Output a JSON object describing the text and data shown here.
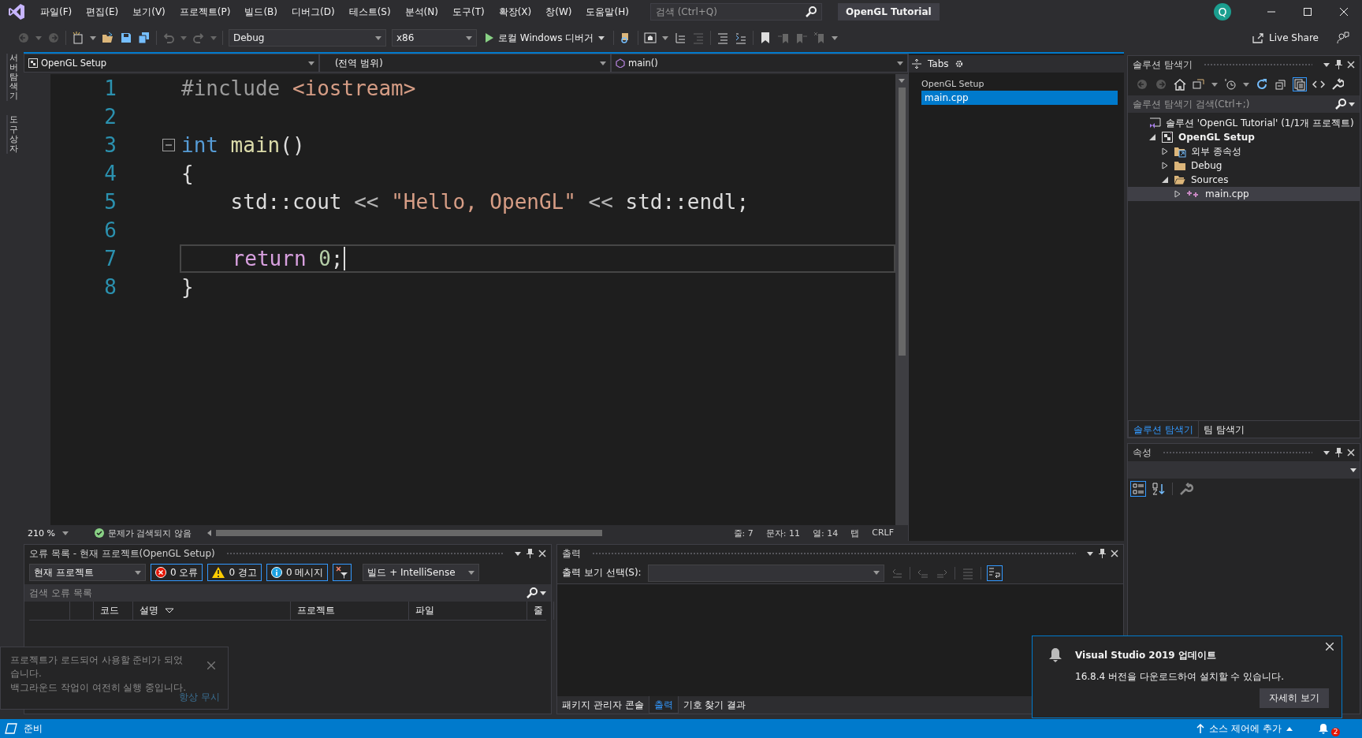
{
  "window": {
    "title": "OpenGL Tutorial"
  },
  "menu": [
    "파일(F)",
    "편집(E)",
    "보기(V)",
    "프로젝트(P)",
    "빌드(B)",
    "디버그(D)",
    "테스트(S)",
    "분석(N)",
    "도구(T)",
    "확장(X)",
    "창(W)",
    "도움말(H)"
  ],
  "search": {
    "placeholder": "검색 (Ctrl+Q)"
  },
  "account": {
    "initial": "Q"
  },
  "toolbar": {
    "configuration": "Debug",
    "platform": "x86",
    "run": "로컬 Windows 디버거",
    "live_share": "Live Share"
  },
  "side_tabs": [
    "서버 탐색기",
    "도구 상자"
  ],
  "editor": {
    "project": "OpenGL Setup",
    "scope": "(전역 범위)",
    "member": "main()",
    "lines": [
      {
        "number": "1",
        "foldable": false,
        "current": false,
        "tokens": [
          {
            "text": "#include ",
            "kind": "preproc"
          },
          {
            "text": "<iostream>",
            "kind": "string"
          }
        ]
      },
      {
        "number": "2",
        "foldable": false,
        "current": false
      },
      {
        "number": "3",
        "foldable": true,
        "current": false,
        "tokens": [
          {
            "text": "int",
            "kind": "keyword"
          },
          {
            "text": " main",
            "kind": "func"
          },
          {
            "text": "()",
            "kind": "plain"
          }
        ]
      },
      {
        "number": "4",
        "foldable": false,
        "current": false,
        "tokens": [
          {
            "text": "{",
            "kind": "plain"
          }
        ]
      },
      {
        "number": "5",
        "foldable": false,
        "current": false,
        "tokens": [
          {
            "text": "    std::cout",
            "kind": "plain"
          },
          {
            "text": " << ",
            "kind": "punct"
          },
          {
            "text": "\"Hello, OpenGL\"",
            "kind": "string"
          },
          {
            "text": " << ",
            "kind": "punct"
          },
          {
            "text": "std::endl;",
            "kind": "plain"
          }
        ]
      },
      {
        "number": "6",
        "foldable": false,
        "current": false
      },
      {
        "number": "7",
        "foldable": false,
        "current": true,
        "tokens": [
          {
            "text": "    return",
            "kind": "control"
          },
          {
            "text": " 0",
            "kind": "number"
          },
          {
            "text": ";",
            "kind": "plain"
          }
        ]
      },
      {
        "number": "8",
        "foldable": false,
        "current": false,
        "tokens": [
          {
            "text": "}",
            "kind": "plain"
          }
        ]
      }
    ],
    "zoom": "210 %",
    "issues": "문제가 검색되지 않음",
    "position": [
      "줄: 7",
      "문자: 11",
      "열: 14",
      "탭",
      "CRLF"
    ]
  },
  "tabs_panel": {
    "title": "Tabs",
    "groups": [
      {
        "name": "OpenGL Setup",
        "items": [
          {
            "label": "main.cpp",
            "selected": true
          }
        ]
      }
    ]
  },
  "solution_explorer": {
    "title": "솔루션 탐색기",
    "search_placeholder": "솔루션 탐색기 검색(Ctrl+;)",
    "tree": [
      {
        "kind": "solution",
        "label": "솔루션 'OpenGL Tutorial' (1/1개 프로젝트)",
        "selected": false,
        "children": [
          {
            "kind": "project",
            "label": "OpenGL Setup",
            "expanded": true,
            "selected": false,
            "children": [
              {
                "kind": "references",
                "label": "외부 종속성",
                "expanded": false,
                "selected": false
              },
              {
                "kind": "folder",
                "label": "Debug",
                "expanded": false,
                "selected": false
              },
              {
                "kind": "folder",
                "label": "Sources",
                "expanded": true,
                "selected": false,
                "children": [
                  {
                    "kind": "file",
                    "label": "main.cpp",
                    "expanded": false,
                    "selected": true
                  }
                ]
              }
            ]
          }
        ]
      }
    ],
    "tabs": [
      {
        "label": "솔루션 탐색기",
        "selected": true
      },
      {
        "label": "팀 탐색기",
        "selected": false
      }
    ]
  },
  "properties": {
    "title": "속성"
  },
  "error_list": {
    "title": "오류 목록 - 현재 프로젝트(OpenGL Setup)",
    "scope": "현재 프로젝트",
    "filters": [
      {
        "kind": "error",
        "label": "0 오류",
        "selected": true
      },
      {
        "kind": "warning",
        "label": "0 경고",
        "selected": true
      },
      {
        "kind": "info",
        "label": "0 메시지",
        "selected": true
      }
    ],
    "source": "빌드 + IntelliSense",
    "search_placeholder": "검색 오류 목록",
    "columns": [
      {
        "label": "코드",
        "sorted": false
      },
      {
        "label": "설명",
        "sorted": true
      },
      {
        "label": "프로젝트",
        "sorted": false
      },
      {
        "label": "파일",
        "sorted": false
      },
      {
        "label": "줄",
        "sorted": false
      }
    ]
  },
  "output": {
    "title": "출력",
    "source_label": "출력 보기 선택(S):",
    "tabs": [
      {
        "label": "패키지 관리자 콘솔",
        "selected": false
      },
      {
        "label": "출력",
        "selected": true
      },
      {
        "label": "기호 찾기 결과",
        "selected": false
      }
    ]
  },
  "status_bar": {
    "text": "준비",
    "source_control": "소스 제어에 추가",
    "notifications": "2"
  },
  "update_notice": {
    "title": "Visual Studio 2019 업데이트",
    "message": "16.8.4 버전을 다운로드하여 설치할 수 있습니다.",
    "button": "자세히 보기"
  },
  "load_toast": {
    "message": "프로젝트가 로드되어 사용할 준비가 되었습니다.",
    "detail": "백그라운드 작업이 여전히 실행 중입니다.",
    "link": "항상 무시"
  }
}
